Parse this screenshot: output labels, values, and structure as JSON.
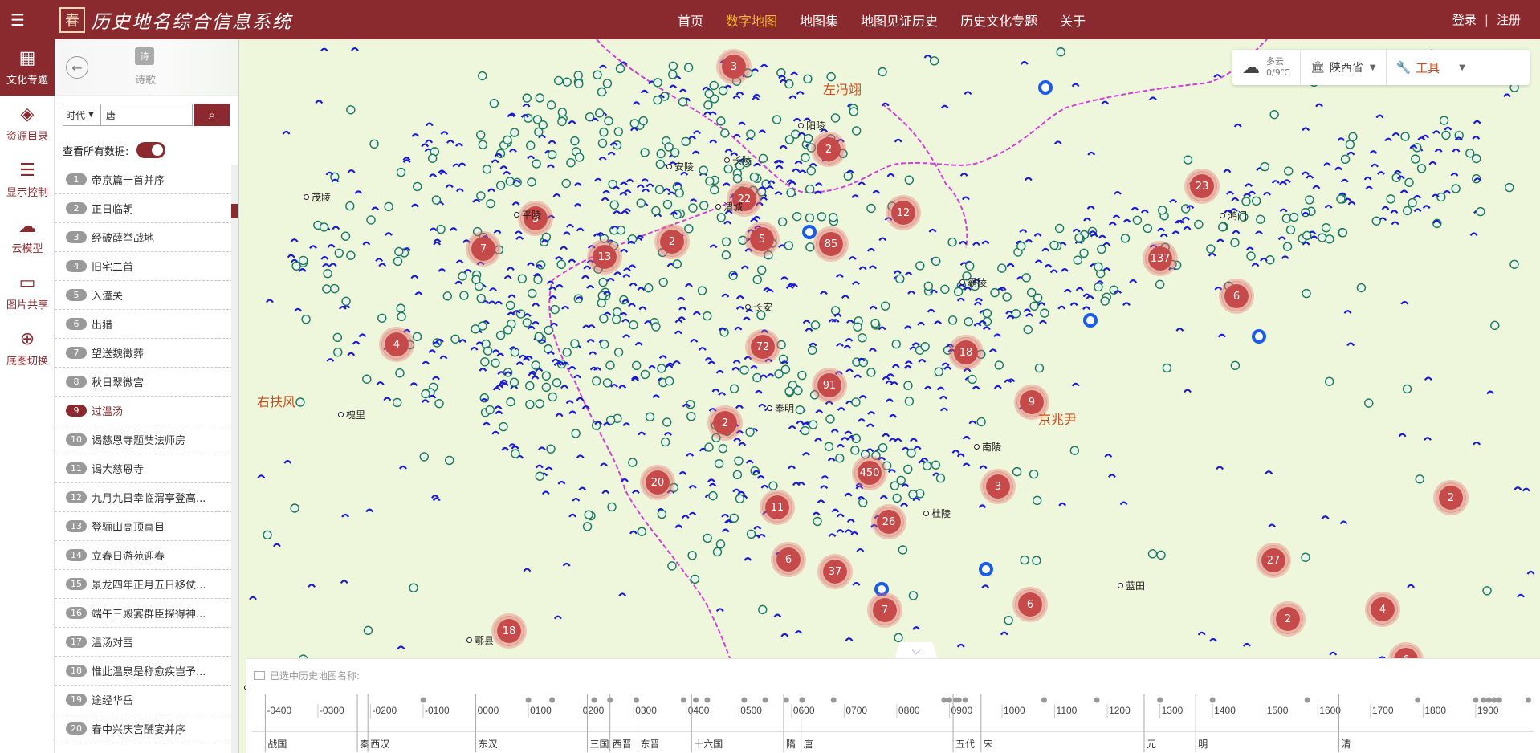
{
  "app": {
    "title": "历史地名综合信息系统",
    "seal": "春"
  },
  "nav": {
    "items": [
      {
        "label": "首页",
        "active": false
      },
      {
        "label": "数字地图",
        "active": true
      },
      {
        "label": "地图集",
        "active": false
      },
      {
        "label": "地图见证历史",
        "active": false
      },
      {
        "label": "历史文化专题",
        "active": false
      },
      {
        "label": "关于",
        "active": false
      }
    ],
    "login": "登录",
    "register": "注册",
    "separator": "|"
  },
  "rail": {
    "items": [
      {
        "label": "文化专题",
        "icon": "grid-icon",
        "glyph": "▦",
        "active": true
      },
      {
        "label": "资源目录",
        "icon": "layers-icon",
        "glyph": "◈",
        "active": false
      },
      {
        "label": "显示控制",
        "icon": "sliders-icon",
        "glyph": "☰",
        "active": false
      },
      {
        "label": "云模型",
        "icon": "cloud-model-icon",
        "glyph": "☁",
        "active": false
      },
      {
        "label": "图片共享",
        "icon": "monitor-icon",
        "glyph": "▭",
        "active": false
      },
      {
        "label": "底图切换",
        "icon": "globe-icon",
        "glyph": "⊕",
        "active": false
      }
    ]
  },
  "panel": {
    "badge": "诗",
    "title": "诗歌",
    "era_select": "时代",
    "search_value": "唐",
    "show_all_label": "查看所有数据:",
    "poems": [
      {
        "n": "1",
        "title": "帝京篇十首并序"
      },
      {
        "n": "2",
        "title": "正日临朝"
      },
      {
        "n": "3",
        "title": "经破薛举战地"
      },
      {
        "n": "4",
        "title": "旧宅二首"
      },
      {
        "n": "5",
        "title": "入潼关"
      },
      {
        "n": "6",
        "title": "出猎"
      },
      {
        "n": "7",
        "title": "望送魏徵葬"
      },
      {
        "n": "8",
        "title": "秋日翠微宫"
      },
      {
        "n": "9",
        "title": "过温汤",
        "active": true
      },
      {
        "n": "10",
        "title": "谒慈恩寺题奘法师房"
      },
      {
        "n": "11",
        "title": "谒大慈恩寺"
      },
      {
        "n": "12",
        "title": "九月九日幸临渭亭登高..."
      },
      {
        "n": "13",
        "title": "登骊山高顶寓目"
      },
      {
        "n": "14",
        "title": "立春日游苑迎春"
      },
      {
        "n": "15",
        "title": "景龙四年正月五日移仗..."
      },
      {
        "n": "16",
        "title": "端午三殿宴群臣探得神..."
      },
      {
        "n": "17",
        "title": "温汤对雪"
      },
      {
        "n": "18",
        "title": "惟此温泉是称愈疾岂予..."
      },
      {
        "n": "19",
        "title": "途经华岳"
      },
      {
        "n": "20",
        "title": "春中兴庆宫酺宴并序"
      }
    ]
  },
  "widget": {
    "weather": "多云",
    "temp": "0/9℃",
    "province": "陕西省",
    "tools": "工具"
  },
  "map": {
    "clusters": [
      {
        "label": "3"
      },
      {
        "label": "2"
      },
      {
        "label": "22"
      },
      {
        "label": "23"
      },
      {
        "label": "3"
      },
      {
        "label": "7"
      },
      {
        "label": "13"
      },
      {
        "label": "2"
      },
      {
        "label": "5"
      },
      {
        "label": "85"
      },
      {
        "label": "12"
      },
      {
        "label": "137"
      },
      {
        "label": "6"
      },
      {
        "label": "4"
      },
      {
        "label": "72"
      },
      {
        "label": "18"
      },
      {
        "label": "91"
      },
      {
        "label": "2"
      },
      {
        "label": "9"
      },
      {
        "label": "450"
      },
      {
        "label": "20"
      },
      {
        "label": "11"
      },
      {
        "label": "3"
      },
      {
        "label": "26"
      },
      {
        "label": "6"
      },
      {
        "label": "37"
      },
      {
        "label": "27"
      },
      {
        "label": "2"
      },
      {
        "label": "18"
      },
      {
        "label": "7"
      },
      {
        "label": "6"
      },
      {
        "label": "4"
      },
      {
        "label": "2"
      },
      {
        "label": "6"
      }
    ],
    "places": [
      {
        "name": "阳陵"
      },
      {
        "name": "安陵"
      },
      {
        "name": "长陵"
      },
      {
        "name": "茂陵"
      },
      {
        "name": "平陵"
      },
      {
        "name": "渭城"
      },
      {
        "name": "鸿门"
      },
      {
        "name": "霸陵"
      },
      {
        "name": "长安"
      },
      {
        "name": "槐里"
      },
      {
        "name": "奉明"
      },
      {
        "name": "南陵"
      },
      {
        "name": "杜陵"
      },
      {
        "name": "蓝田"
      },
      {
        "name": "鄠县"
      },
      {
        "name": "甘亭"
      }
    ],
    "regions": [
      {
        "name": "左冯翊"
      },
      {
        "name": "右扶风"
      },
      {
        "name": "京兆尹"
      }
    ]
  },
  "timeline": {
    "caption": "已选中历史地图名称:",
    "years": [
      "-0400",
      "-0300",
      "-0200",
      "-0100",
      "0000",
      "0100",
      "0200",
      "0300",
      "0400",
      "0500",
      "0600",
      "0700",
      "0800",
      "0900",
      "1000",
      "1100",
      "1200",
      "1300",
      "1400",
      "1500",
      "1600",
      "1700",
      "1800",
      "1900"
    ],
    "dynasties": [
      {
        "name": "战国",
        "year": -400
      },
      {
        "name": "秦",
        "year": -225
      },
      {
        "name": "西汉",
        "year": -205
      },
      {
        "name": "东汉",
        "year": 0
      },
      {
        "name": "三国",
        "year": 212
      },
      {
        "name": "西晋",
        "year": 255
      },
      {
        "name": "东晋",
        "year": 308
      },
      {
        "name": "十六国",
        "year": 410
      },
      {
        "name": "隋",
        "year": 585
      },
      {
        "name": "唐",
        "year": 618
      },
      {
        "name": "五代",
        "year": 907
      },
      {
        "name": "宋",
        "year": 960
      },
      {
        "name": "元",
        "year": 1270
      },
      {
        "name": "明",
        "year": 1368
      },
      {
        "name": "清",
        "year": 1640
      }
    ],
    "markers": [
      -100,
      100,
      145,
      225,
      255,
      305,
      395,
      418,
      440,
      510,
      550,
      590,
      620,
      680,
      890,
      900,
      912,
      918,
      930,
      1080,
      1180,
      1300,
      1400,
      1580,
      1790,
      1900,
      1915,
      1925,
      1935,
      1945,
      2000
    ]
  },
  "colors": {
    "brand": "#8b2a2e",
    "nav_active": "#f5b73c",
    "map_bg": "#eef6dc",
    "cluster": "#c64a4a",
    "boundary": "#d040d8",
    "marker_blue": "#1a1ad6",
    "marker_teal": "#1a7a5a",
    "region_text": "#c7501e"
  }
}
